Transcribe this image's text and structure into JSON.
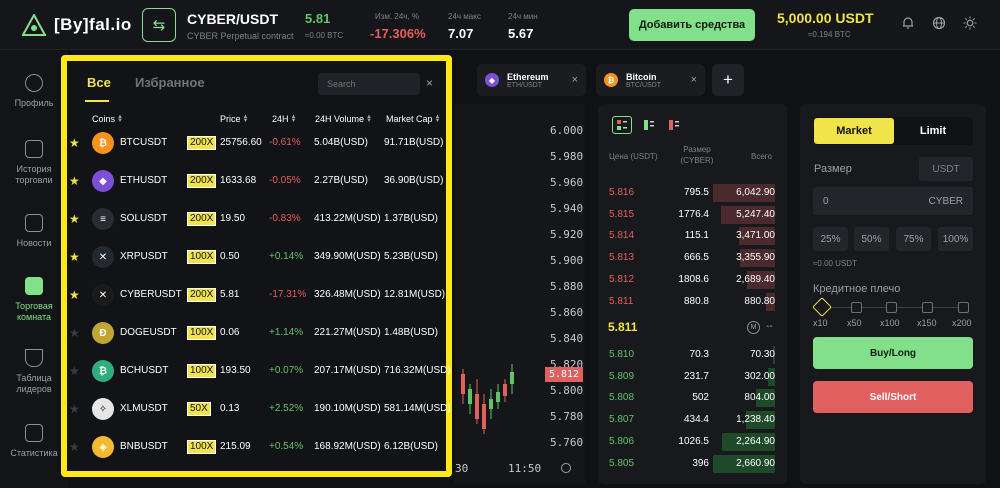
{
  "header": {
    "logo_text": "[By]fal.io",
    "pair": "CYBER/USDT",
    "pair_sub": "CYBER Perpetual contract",
    "last_price": "5.81",
    "last_price_sub": "≈0.00 BTC",
    "change_label": "Изм. 24ч, %",
    "change_value": "-17.306%",
    "high_label": "24ч макс",
    "high_value": "7.07",
    "low_label": "24ч мин",
    "low_value": "5.67",
    "add_funds": "Добавить средства",
    "balance": "5,000.00 USDT",
    "balance_sub": "≈0.194 BTC",
    "icons": [
      "bell-icon",
      "globe-icon",
      "sun-icon"
    ]
  },
  "nav": {
    "items": [
      {
        "label": "Профиль",
        "icon": "user-icon"
      },
      {
        "label": "История торговли",
        "icon": "history-icon"
      },
      {
        "label": "Новости",
        "icon": "news-icon"
      },
      {
        "label": "Торговая комната",
        "icon": "trading-icon",
        "active": true
      },
      {
        "label": "Таблица лидеров",
        "icon": "trophy-icon"
      },
      {
        "label": "Статистика",
        "icon": "stats-icon"
      }
    ]
  },
  "tabs": [
    {
      "name": "Ethereum",
      "sub": "ETH/USDT"
    },
    {
      "name": "Bitcoin",
      "sub": "BTC/USDT"
    }
  ],
  "chart": {
    "y_ticks": [
      "6.000",
      "5.980",
      "5.960",
      "5.940",
      "5.920",
      "5.900",
      "5.880",
      "5.860",
      "5.840",
      "5.820",
      "5.800",
      "5.780",
      "5.760"
    ],
    "current_price": "5.812",
    "x_ticks": [
      "30",
      "11:50"
    ]
  },
  "orderbook": {
    "col_price": "Цена (USDT)",
    "col_size": "Размер (CYBER)",
    "col_total": "Всего",
    "asks": [
      {
        "price": "5.816",
        "size": "795.5",
        "total": "6,042.90",
        "depth": 1.0
      },
      {
        "price": "5.815",
        "size": "1776.4",
        "total": "5,247.40",
        "depth": 0.87
      },
      {
        "price": "5.814",
        "size": "115.1",
        "total": "3,471.00",
        "depth": 0.58
      },
      {
        "price": "5.813",
        "size": "666.5",
        "total": "3,355.90",
        "depth": 0.56
      },
      {
        "price": "5.812",
        "size": "1808.6",
        "total": "2,689.40",
        "depth": 0.45
      },
      {
        "price": "5.811",
        "size": "880.8",
        "total": "880.80",
        "depth": 0.15
      }
    ],
    "mid_price": "5.811",
    "mid_icon": "M",
    "mid_dash": "--",
    "bids": [
      {
        "price": "5.810",
        "size": "70.3",
        "total": "70.30",
        "depth": 0.03
      },
      {
        "price": "5.809",
        "size": "231.7",
        "total": "302.00",
        "depth": 0.11
      },
      {
        "price": "5.808",
        "size": "502",
        "total": "804.00",
        "depth": 0.3
      },
      {
        "price": "5.807",
        "size": "434.4",
        "total": "1,238.40",
        "depth": 0.46
      },
      {
        "price": "5.806",
        "size": "1026.5",
        "total": "2,264.90",
        "depth": 0.85
      },
      {
        "price": "5.805",
        "size": "396",
        "total": "2,660.90",
        "depth": 1.0
      }
    ]
  },
  "order_form": {
    "market": "Market",
    "limit": "Limit",
    "size_label": "Размер",
    "unit_usdt": "USDT",
    "size_value": "0",
    "unit_cyber": "CYBER",
    "pcts": [
      "25%",
      "50%",
      "75%",
      "100%"
    ],
    "approx": "≈0.00 USDT",
    "leverage_label": "Кредитное плечо",
    "leverage_levels": [
      "x10",
      "x50",
      "x100",
      "x150",
      "x200"
    ],
    "buy": "Buy/Long",
    "sell": "Sell/Short"
  },
  "coin_panel": {
    "tab_all": "Все",
    "tab_favorites": "Избранное",
    "search_placeholder": "Search",
    "close": "×",
    "columns": {
      "coins": "Coins",
      "price": "Price",
      "change": "24H",
      "volume": "24H Volume",
      "cap": "Market Cap"
    },
    "rows": [
      {
        "symbol": "BTCUSDT",
        "leverage": "200X",
        "price": "25756.60",
        "change": "-0.61%",
        "volume": "5.04B(USD)",
        "cap": "91.71B(USD)",
        "fav": true,
        "color": "#f7931a",
        "glyph": "₿"
      },
      {
        "symbol": "ETHUSDT",
        "leverage": "200X",
        "price": "1633.68",
        "change": "-0.05%",
        "volume": "2.27B(USD)",
        "cap": "36.90B(USD)",
        "fav": true,
        "color": "#7b4fd8",
        "glyph": "◆"
      },
      {
        "symbol": "SOLUSDT",
        "leverage": "200X",
        "price": "19.50",
        "change": "-0.83%",
        "volume": "413.22M(USD)",
        "cap": "1.37B(USD)",
        "fav": true,
        "color": "#2b2b33",
        "glyph": "≡"
      },
      {
        "symbol": "XRPUSDT",
        "leverage": "100X",
        "price": "0.50",
        "change": "+0.14%",
        "volume": "349.90M(USD)",
        "cap": "5.23B(USD)",
        "fav": true,
        "color": "#23292f",
        "glyph": "✕"
      },
      {
        "symbol": "CYBERUSDT",
        "leverage": "200X",
        "price": "5.81",
        "change": "-17.31%",
        "volume": "326.48M(USD)",
        "cap": "12.81M(USD)",
        "fav": true,
        "color": "#1a1a1a",
        "glyph": "✕"
      },
      {
        "symbol": "DOGEUSDT",
        "leverage": "100X",
        "price": "0.06",
        "change": "+1.14%",
        "volume": "221.27M(USD)",
        "cap": "1.48B(USD)",
        "fav": false,
        "color": "#c2a633",
        "glyph": "Ð"
      },
      {
        "symbol": "BCHUSDT",
        "leverage": "100X",
        "price": "193.50",
        "change": "+0.07%",
        "volume": "207.17M(USD)",
        "cap": "716.32M(USD)",
        "fav": false,
        "color": "#2fae7d",
        "glyph": "₿"
      },
      {
        "symbol": "XLMUSDT",
        "leverage": "50X",
        "price": "0.13",
        "change": "+2.52%",
        "volume": "190.10M(USD)",
        "cap": "581.14M(USD)",
        "fav": false,
        "color": "#e6e6e6",
        "glyph": "✧"
      },
      {
        "symbol": "BNBUSDT",
        "leverage": "100X",
        "price": "215.09",
        "change": "+0.54%",
        "volume": "168.92M(USD)",
        "cap": "6.12B(USD)",
        "fav": false,
        "color": "#f3ba2f",
        "glyph": "◈"
      }
    ]
  },
  "colors": {
    "accent_green": "#83e08a",
    "accent_yellow": "#f1e34a",
    "up": "#62c26a",
    "down": "#ea5c5c",
    "highlight_border": "#ffe81a"
  }
}
